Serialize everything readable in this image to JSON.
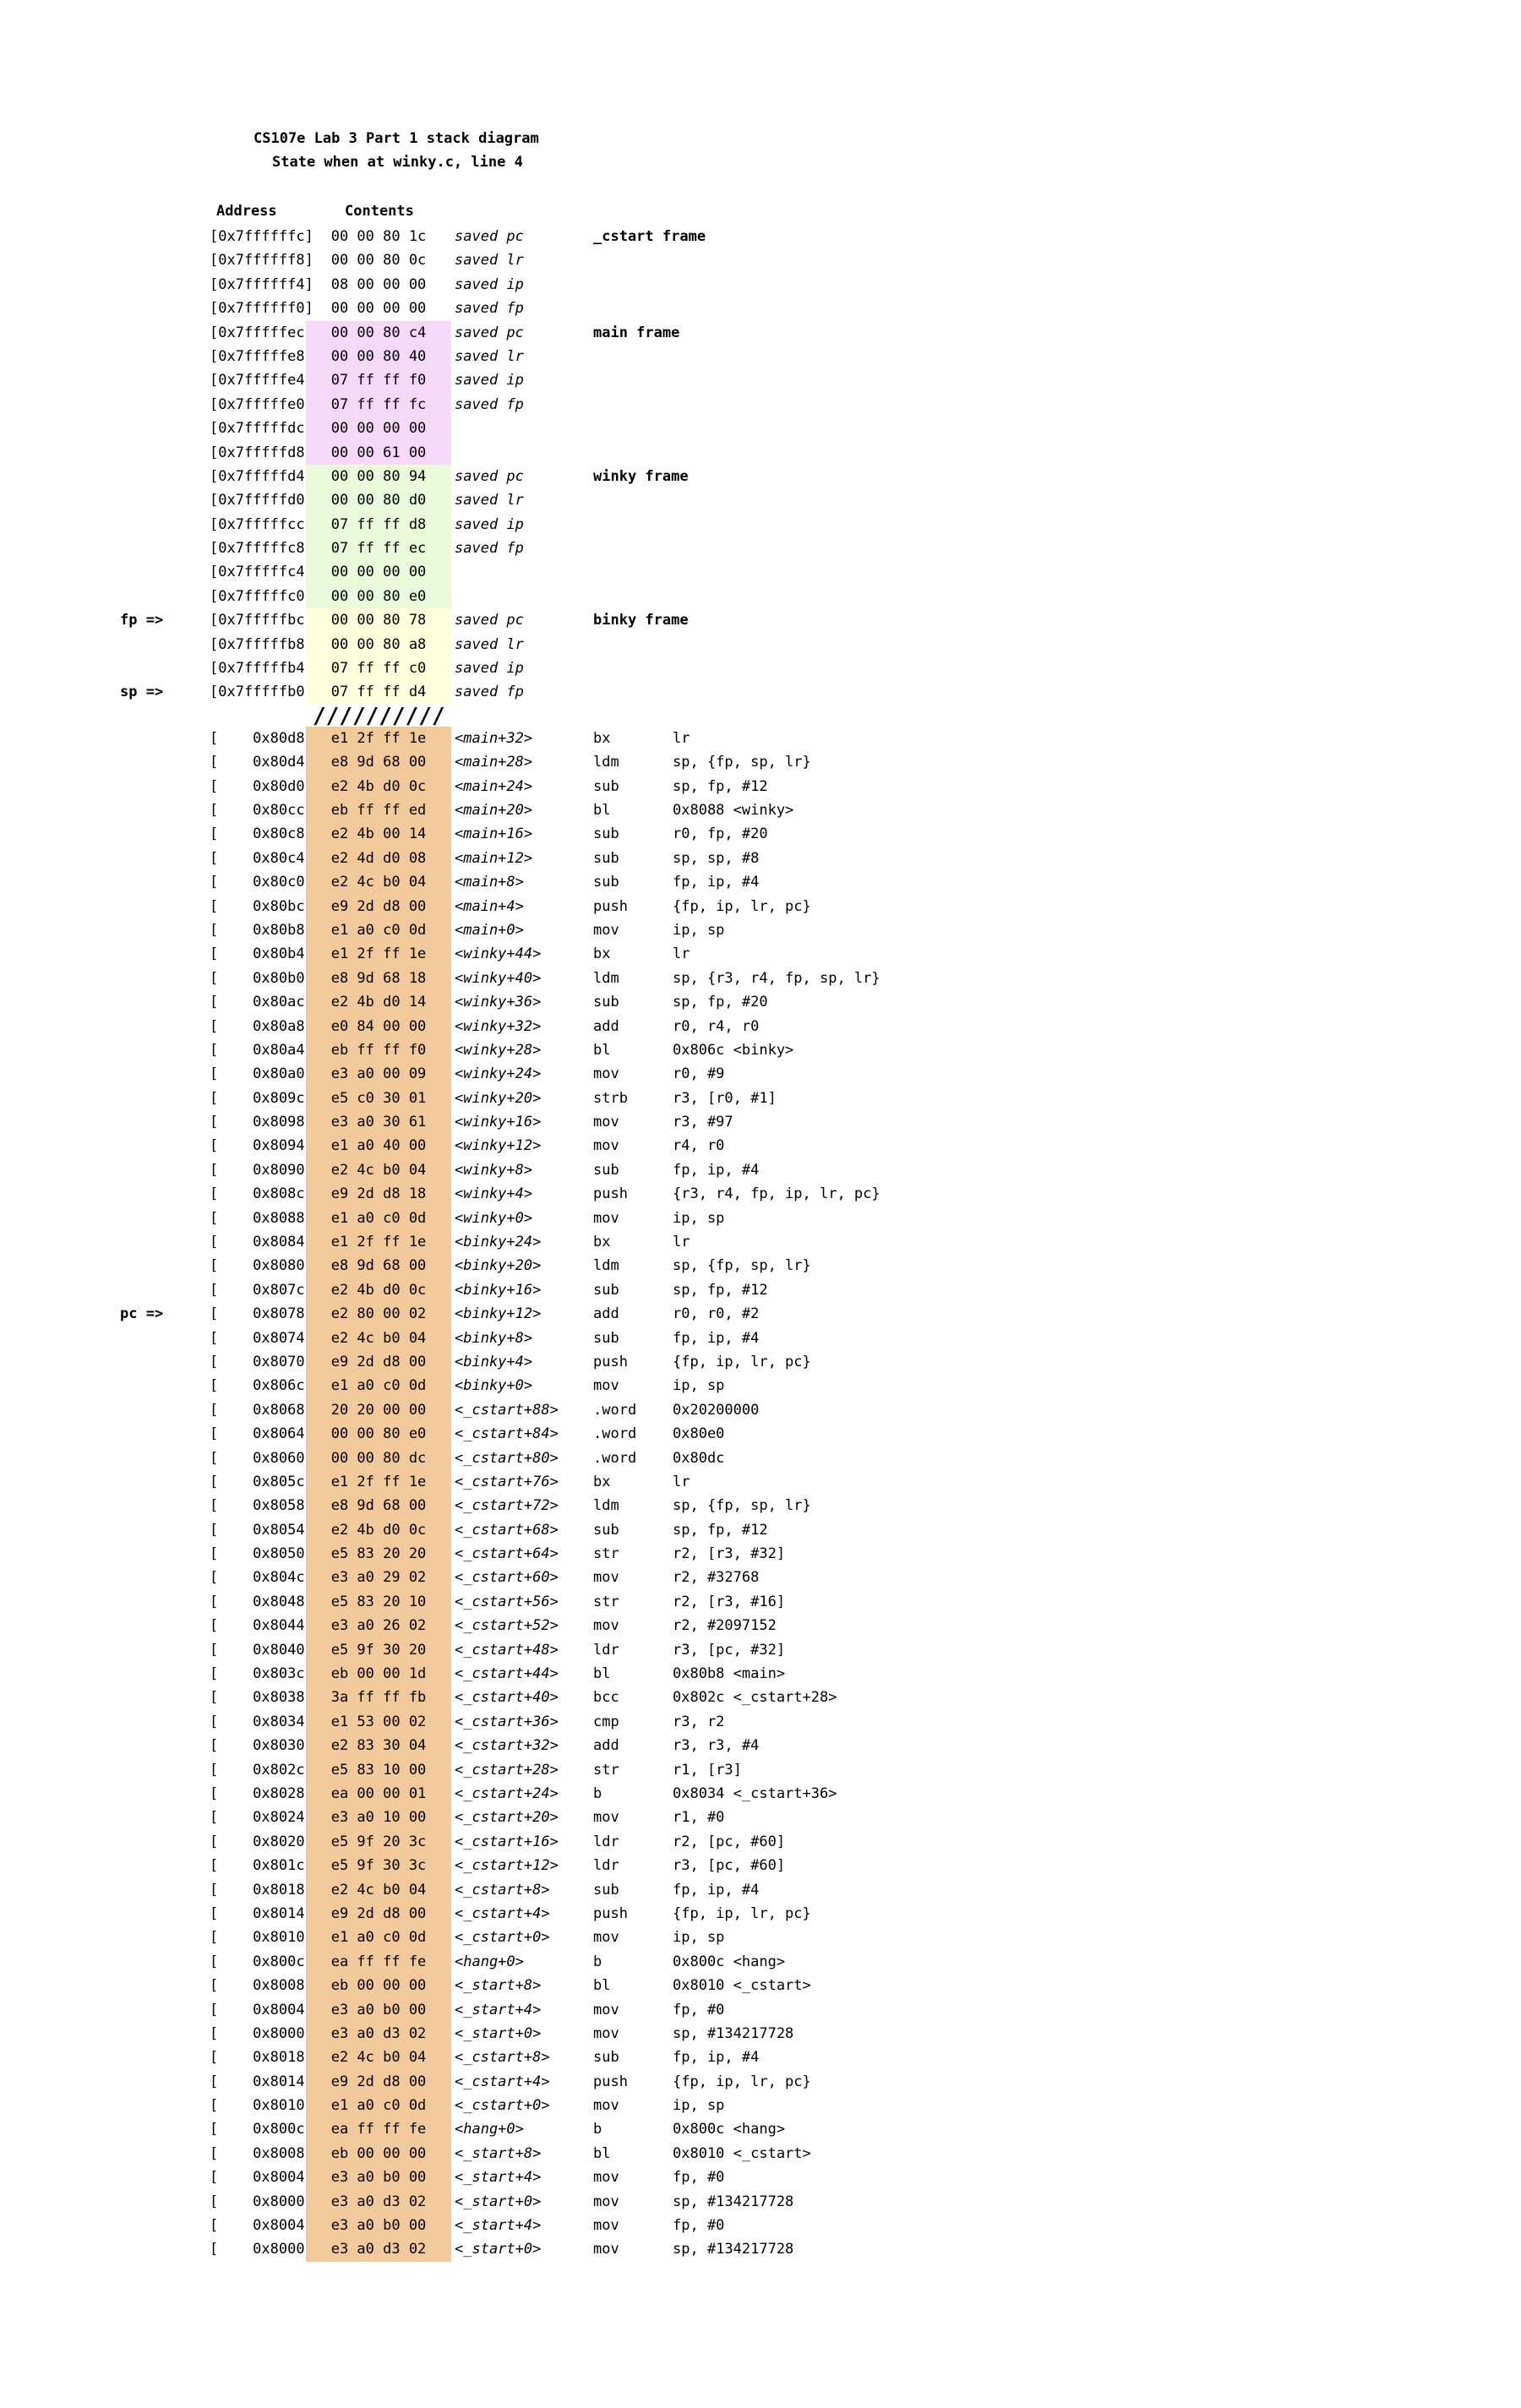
{
  "title": "CS107e Lab 3 Part 1 stack diagram",
  "subtitle": "State when at winky.c, line 4",
  "headers": {
    "address": "Address",
    "contents": "Contents"
  },
  "divider": "//////////",
  "colors": {
    "_cstart": "#e6fbff",
    "main": "#f6d9f9",
    "winky": "#e9fbdb",
    "binky": "#ffffde",
    "code": "#f1c99a"
  },
  "stack": [
    {
      "addr": "[0x7ffffffc]",
      "contents": "00 00 80 1c",
      "note": "saved pc",
      "label": "_cstart frame",
      "frame": "_cstart"
    },
    {
      "addr": "[0x7ffffff8]",
      "contents": "00 00 80 0c",
      "note": "saved lr",
      "frame": "_cstart"
    },
    {
      "addr": "[0x7ffffff4]",
      "contents": "08 00 00 00",
      "note": "saved ip",
      "frame": "_cstart"
    },
    {
      "addr": "[0x7ffffff0]",
      "contents": "00 00 00 00",
      "note": "saved fp",
      "frame": "_cstart"
    },
    {
      "addr": "[0x7fffffec]",
      "contents": "00 00 80 c4",
      "note": "saved pc",
      "label": "main frame",
      "frame": "main"
    },
    {
      "addr": "[0x7fffffe8]",
      "contents": "00 00 80 40",
      "note": "saved lr",
      "frame": "main"
    },
    {
      "addr": "[0x7fffffe4]",
      "contents": "07 ff ff f0",
      "note": "saved ip",
      "frame": "main"
    },
    {
      "addr": "[0x7fffffe0]",
      "contents": "07 ff ff fc",
      "note": "saved fp",
      "frame": "main"
    },
    {
      "addr": "[0x7fffffdc]",
      "contents": "00 00 00 00",
      "frame": "main"
    },
    {
      "addr": "[0x7fffffd8]",
      "contents": "00 00 61 00",
      "frame": "main"
    },
    {
      "addr": "[0x7fffffd4]",
      "contents": "00 00 80 94",
      "note": "saved pc",
      "label": "winky frame",
      "frame": "winky"
    },
    {
      "addr": "[0x7fffffd0]",
      "contents": "00 00 80 d0",
      "note": "saved lr",
      "frame": "winky"
    },
    {
      "addr": "[0x7fffffcc]",
      "contents": "07 ff ff d8",
      "note": "saved ip",
      "frame": "winky"
    },
    {
      "addr": "[0x7fffffc8]",
      "contents": "07 ff ff ec",
      "note": "saved fp",
      "frame": "winky"
    },
    {
      "addr": "[0x7fffffc4]",
      "contents": "00 00 00 00",
      "frame": "winky"
    },
    {
      "addr": "[0x7fffffc0]",
      "contents": "00 00 80 e0",
      "frame": "winky"
    },
    {
      "addr": "[0x7fffffbc]",
      "contents": "00 00 80 78",
      "note": "saved pc",
      "label": "binky frame",
      "frame": "binky",
      "pointer": "fp =>"
    },
    {
      "addr": "[0x7fffffb8]",
      "contents": "00 00 80 a8",
      "note": "saved lr",
      "frame": "binky"
    },
    {
      "addr": "[0x7fffffb4]",
      "contents": "07 ff ff c0",
      "note": "saved ip",
      "frame": "binky"
    },
    {
      "addr": "[0x7fffffb0]",
      "contents": "07 ff ff d4",
      "note": "saved fp",
      "frame": "binky",
      "pointer": "sp =>"
    }
  ],
  "code": [
    {
      "addr": "[    0x80d8]",
      "contents": "e1 2f ff 1e",
      "note": "<main+32>",
      "op": "bx",
      "arg": "lr"
    },
    {
      "addr": "[    0x80d4]",
      "contents": "e8 9d 68 00",
      "note": "<main+28>",
      "op": "ldm",
      "arg": "sp, {fp, sp, lr}"
    },
    {
      "addr": "[    0x80d0]",
      "contents": "e2 4b d0 0c",
      "note": "<main+24>",
      "op": "sub",
      "arg": "sp, fp, #12"
    },
    {
      "addr": "[    0x80cc]",
      "contents": "eb ff ff ed",
      "note": "<main+20>",
      "op": "bl",
      "arg": "0x8088 <winky>"
    },
    {
      "addr": "[    0x80c8]",
      "contents": "e2 4b 00 14",
      "note": "<main+16>",
      "op": "sub",
      "arg": "r0, fp, #20"
    },
    {
      "addr": "[    0x80c4]",
      "contents": "e2 4d d0 08",
      "note": "<main+12>",
      "op": "sub",
      "arg": "sp, sp, #8"
    },
    {
      "addr": "[    0x80c0]",
      "contents": "e2 4c b0 04",
      "note": "<main+8>",
      "op": "sub",
      "arg": "fp, ip, #4"
    },
    {
      "addr": "[    0x80bc]",
      "contents": "e9 2d d8 00",
      "note": "<main+4>",
      "op": "push",
      "arg": "{fp, ip, lr, pc}"
    },
    {
      "addr": "[    0x80b8]",
      "contents": "e1 a0 c0 0d",
      "note": "<main+0>",
      "op": "mov",
      "arg": "ip, sp"
    },
    {
      "addr": "[    0x80b4]",
      "contents": "e1 2f ff 1e",
      "note": "<winky+44>",
      "op": "bx",
      "arg": "lr"
    },
    {
      "addr": "[    0x80b0]",
      "contents": "e8 9d 68 18",
      "note": "<winky+40>",
      "op": "ldm",
      "arg": "sp, {r3, r4, fp, sp, lr}"
    },
    {
      "addr": "[    0x80ac]",
      "contents": "e2 4b d0 14",
      "note": "<winky+36>",
      "op": "sub",
      "arg": "sp, fp, #20"
    },
    {
      "addr": "[    0x80a8]",
      "contents": "e0 84 00 00",
      "note": "<winky+32>",
      "op": "add",
      "arg": "r0, r4, r0"
    },
    {
      "addr": "[    0x80a4]",
      "contents": "eb ff ff f0",
      "note": "<winky+28>",
      "op": "bl",
      "arg": "0x806c <binky>"
    },
    {
      "addr": "[    0x80a0]",
      "contents": "e3 a0 00 09",
      "note": "<winky+24>",
      "op": "mov",
      "arg": "r0, #9"
    },
    {
      "addr": "[    0x809c]",
      "contents": "e5 c0 30 01",
      "note": "<winky+20>",
      "op": "strb",
      "arg": "r3, [r0, #1]"
    },
    {
      "addr": "[    0x8098]",
      "contents": "e3 a0 30 61",
      "note": "<winky+16>",
      "op": "mov",
      "arg": "r3, #97"
    },
    {
      "addr": "[    0x8094]",
      "contents": "e1 a0 40 00",
      "note": "<winky+12>",
      "op": "mov",
      "arg": "r4, r0"
    },
    {
      "addr": "[    0x8090]",
      "contents": "e2 4c b0 04",
      "note": "<winky+8>",
      "op": "sub",
      "arg": "fp, ip, #4"
    },
    {
      "addr": "[    0x808c]",
      "contents": "e9 2d d8 18",
      "note": "<winky+4>",
      "op": "push",
      "arg": "{r3, r4, fp, ip, lr, pc}"
    },
    {
      "addr": "[    0x8088]",
      "contents": "e1 a0 c0 0d",
      "note": "<winky+0>",
      "op": "mov",
      "arg": "ip, sp"
    },
    {
      "addr": "[    0x8084]",
      "contents": "e1 2f ff 1e",
      "note": "<binky+24>",
      "op": "bx",
      "arg": "lr"
    },
    {
      "addr": "[    0x8080]",
      "contents": "e8 9d 68 00",
      "note": "<binky+20>",
      "op": "ldm",
      "arg": "sp, {fp, sp, lr}"
    },
    {
      "addr": "[    0x807c]",
      "contents": "e2 4b d0 0c",
      "note": "<binky+16>",
      "op": "sub",
      "arg": "sp, fp, #12"
    },
    {
      "addr": "[    0x8078]",
      "contents": "e2 80 00 02",
      "note": "<binky+12>",
      "op": "add",
      "arg": "r0, r0, #2",
      "pointer": "pc =>"
    },
    {
      "addr": "[    0x8074]",
      "contents": "e2 4c b0 04",
      "note": "<binky+8>",
      "op": "sub",
      "arg": "fp, ip, #4"
    },
    {
      "addr": "[    0x8070]",
      "contents": "e9 2d d8 00",
      "note": "<binky+4>",
      "op": "push",
      "arg": "{fp, ip, lr, pc}"
    },
    {
      "addr": "[    0x806c]",
      "contents": "e1 a0 c0 0d",
      "note": "<binky+0>",
      "op": "mov",
      "arg": "ip, sp"
    },
    {
      "addr": "[    0x8068]",
      "contents": "20 20 00 00",
      "note": "<_cstart+88>",
      "op": ".word",
      "arg": "0x20200000"
    },
    {
      "addr": "[    0x8064]",
      "contents": "00 00 80 e0",
      "note": "<_cstart+84>",
      "op": ".word",
      "arg": "0x80e0"
    },
    {
      "addr": "[    0x8060]",
      "contents": "00 00 80 dc",
      "note": "<_cstart+80>",
      "op": ".word",
      "arg": "0x80dc"
    },
    {
      "addr": "[    0x805c]",
      "contents": "e1 2f ff 1e",
      "note": "<_cstart+76>",
      "op": "bx",
      "arg": "lr"
    },
    {
      "addr": "[    0x8058]",
      "contents": "e8 9d 68 00",
      "note": "<_cstart+72>",
      "op": "ldm",
      "arg": "sp, {fp, sp, lr}"
    },
    {
      "addr": "[    0x8054]",
      "contents": "e2 4b d0 0c",
      "note": "<_cstart+68>",
      "op": "sub",
      "arg": "sp, fp, #12"
    },
    {
      "addr": "[    0x8050]",
      "contents": "e5 83 20 20",
      "note": "<_cstart+64>",
      "op": "str",
      "arg": "r2, [r3, #32]"
    },
    {
      "addr": "[    0x804c]",
      "contents": "e3 a0 29 02",
      "note": "<_cstart+60>",
      "op": "mov",
      "arg": "r2, #32768"
    },
    {
      "addr": "[    0x8048]",
      "contents": "e5 83 20 10",
      "note": "<_cstart+56>",
      "op": "str",
      "arg": "r2, [r3, #16]"
    },
    {
      "addr": "[    0x8044]",
      "contents": "e3 a0 26 02",
      "note": "<_cstart+52>",
      "op": "mov",
      "arg": "r2, #2097152"
    },
    {
      "addr": "[    0x8040]",
      "contents": "e5 9f 30 20",
      "note": "<_cstart+48>",
      "op": "ldr",
      "arg": "r3, [pc, #32]"
    },
    {
      "addr": "[    0x803c]",
      "contents": "eb 00 00 1d",
      "note": "<_cstart+44>",
      "op": "bl",
      "arg": "0x80b8 <main>"
    },
    {
      "addr": "[    0x8038]",
      "contents": "3a ff ff fb",
      "note": "<_cstart+40>",
      "op": "bcc",
      "arg": "0x802c <_cstart+28>"
    },
    {
      "addr": "[    0x8034]",
      "contents": "e1 53 00 02",
      "note": "<_cstart+36>",
      "op": "cmp",
      "arg": "r3, r2"
    },
    {
      "addr": "[    0x8030]",
      "contents": "e2 83 30 04",
      "note": "<_cstart+32>",
      "op": "add",
      "arg": "r3, r3, #4"
    },
    {
      "addr": "[    0x802c]",
      "contents": "e5 83 10 00",
      "note": "<_cstart+28>",
      "op": "str",
      "arg": "r1, [r3]"
    },
    {
      "addr": "[    0x8028]",
      "contents": "ea 00 00 01",
      "note": "<_cstart+24>",
      "op": "b",
      "arg": "0x8034 <_cstart+36>"
    },
    {
      "addr": "[    0x8024]",
      "contents": "e3 a0 10 00",
      "note": "<_cstart+20>",
      "op": "mov",
      "arg": "r1, #0"
    },
    {
      "addr": "[    0x8020]",
      "contents": "e5 9f 20 3c",
      "note": "<_cstart+16>",
      "op": "ldr",
      "arg": "r2, [pc, #60]"
    },
    {
      "addr": "[    0x801c]",
      "contents": "e5 9f 30 3c",
      "note": "<_cstart+12>",
      "op": "ldr",
      "arg": "r3, [pc, #60]"
    },
    {
      "addr": "[    0x8018]",
      "contents": "e2 4c b0 04",
      "note": "<_cstart+8>",
      "op": "sub",
      "arg": "fp, ip, #4"
    },
    {
      "addr": "[    0x8014]",
      "contents": "e9 2d d8 00",
      "note": "<_cstart+4>",
      "op": "push",
      "arg": "{fp, ip, lr, pc}"
    },
    {
      "addr": "[    0x8010]",
      "contents": "e1 a0 c0 0d",
      "note": "<_cstart+0>",
      "op": "mov",
      "arg": "ip, sp"
    },
    {
      "addr": "[    0x800c]",
      "contents": "ea ff ff fe",
      "note": "<hang+0>",
      "op": "b",
      "arg": "0x800c <hang>"
    },
    {
      "addr": "[    0x8008]",
      "contents": "eb 00 00 00",
      "note": "<_start+8>",
      "op": "bl",
      "arg": "0x8010 <_cstart>"
    },
    {
      "addr": "[    0x8004]",
      "contents": "e3 a0 b0 00",
      "note": "<_start+4>",
      "op": "mov",
      "arg": "fp, #0"
    },
    {
      "addr": "[    0x8000]",
      "contents": "e3 a0 d3 02",
      "note": "<_start+0>",
      "op": "mov",
      "arg": "sp, #134217728"
    },
    {
      "addr": "[    0x8018]",
      "contents": "e2 4c b0 04",
      "note": "<_cstart+8>",
      "op": "sub",
      "arg": "fp, ip, #4"
    },
    {
      "addr": "[    0x8014]",
      "contents": "e9 2d d8 00",
      "note": "<_cstart+4>",
      "op": "push",
      "arg": "{fp, ip, lr, pc}"
    },
    {
      "addr": "[    0x8010]",
      "contents": "e1 a0 c0 0d",
      "note": "<_cstart+0>",
      "op": "mov",
      "arg": "ip, sp"
    },
    {
      "addr": "[    0x800c]",
      "contents": "ea ff ff fe",
      "note": "<hang+0>",
      "op": "b",
      "arg": "0x800c <hang>"
    },
    {
      "addr": "[    0x8008]",
      "contents": "eb 00 00 00",
      "note": "<_start+8>",
      "op": "bl",
      "arg": "0x8010 <_cstart>"
    },
    {
      "addr": "[    0x8004]",
      "contents": "e3 a0 b0 00",
      "note": "<_start+4>",
      "op": "mov",
      "arg": "fp, #0"
    },
    {
      "addr": "[    0x8000]",
      "contents": "e3 a0 d3 02",
      "note": "<_start+0>",
      "op": "mov",
      "arg": "sp, #134217728"
    },
    {
      "addr": "[    0x8004]",
      "contents": "e3 a0 b0 00",
      "note": "<_start+4>",
      "op": "mov",
      "arg": "fp, #0"
    },
    {
      "addr": "[    0x8000]",
      "contents": "e3 a0 d3 02",
      "note": "<_start+0>",
      "op": "mov",
      "arg": "sp, #134217728"
    }
  ]
}
